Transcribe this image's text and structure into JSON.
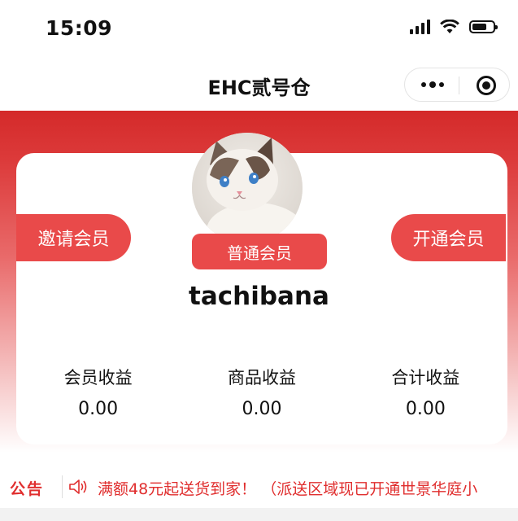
{
  "status_bar": {
    "time": "15:09"
  },
  "nav": {
    "title": "EHC贰号仓"
  },
  "profile": {
    "invite_label": "邀请会员",
    "activate_label": "开通会员",
    "member_level": "普通会员",
    "username": "tachibana"
  },
  "stats": [
    {
      "label": "会员收益",
      "value": "0.00"
    },
    {
      "label": "商品收益",
      "value": "0.00"
    },
    {
      "label": "合计收益",
      "value": "0.00"
    }
  ],
  "notice": {
    "tag": "公告",
    "text": "满额48元起送货到家！ （派送区域现已开通世景华庭小"
  },
  "colors": {
    "accent": "#e94a4a",
    "header_red": "#d42a2a",
    "notice_red": "#e02e2e"
  }
}
